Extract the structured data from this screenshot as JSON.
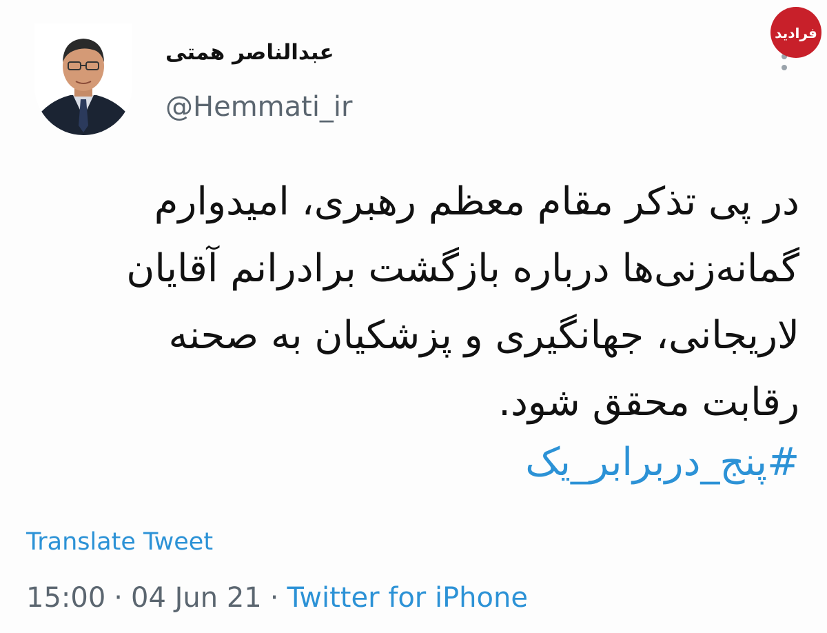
{
  "author": {
    "display_name": "عبدالناصر همتی",
    "handle": "@Hemmati_ir",
    "avatar_icon": "profile-photo"
  },
  "tweet": {
    "text_lines": [
      "در پی تذکر مقام معظم رهبری، امیدوارم",
      "گمانه‌زنی‌ها درباره بازگشت برادرانم آقایان",
      "لاریجانی، جهانگیری و پزشکیان به صحنه",
      "رقابت محقق شود."
    ],
    "hashtag": "#پنج_دربرابر_یک"
  },
  "translate_label": "Translate Tweet",
  "meta": {
    "time": "15:00",
    "separator": "·",
    "date": "04 Jun 21",
    "source": "Twitter for iPhone"
  },
  "watermark": {
    "text": "فرادید",
    "color": "#c8202a"
  },
  "colors": {
    "link": "#2c92d6",
    "text": "#111111",
    "secondary": "#5b6670"
  }
}
